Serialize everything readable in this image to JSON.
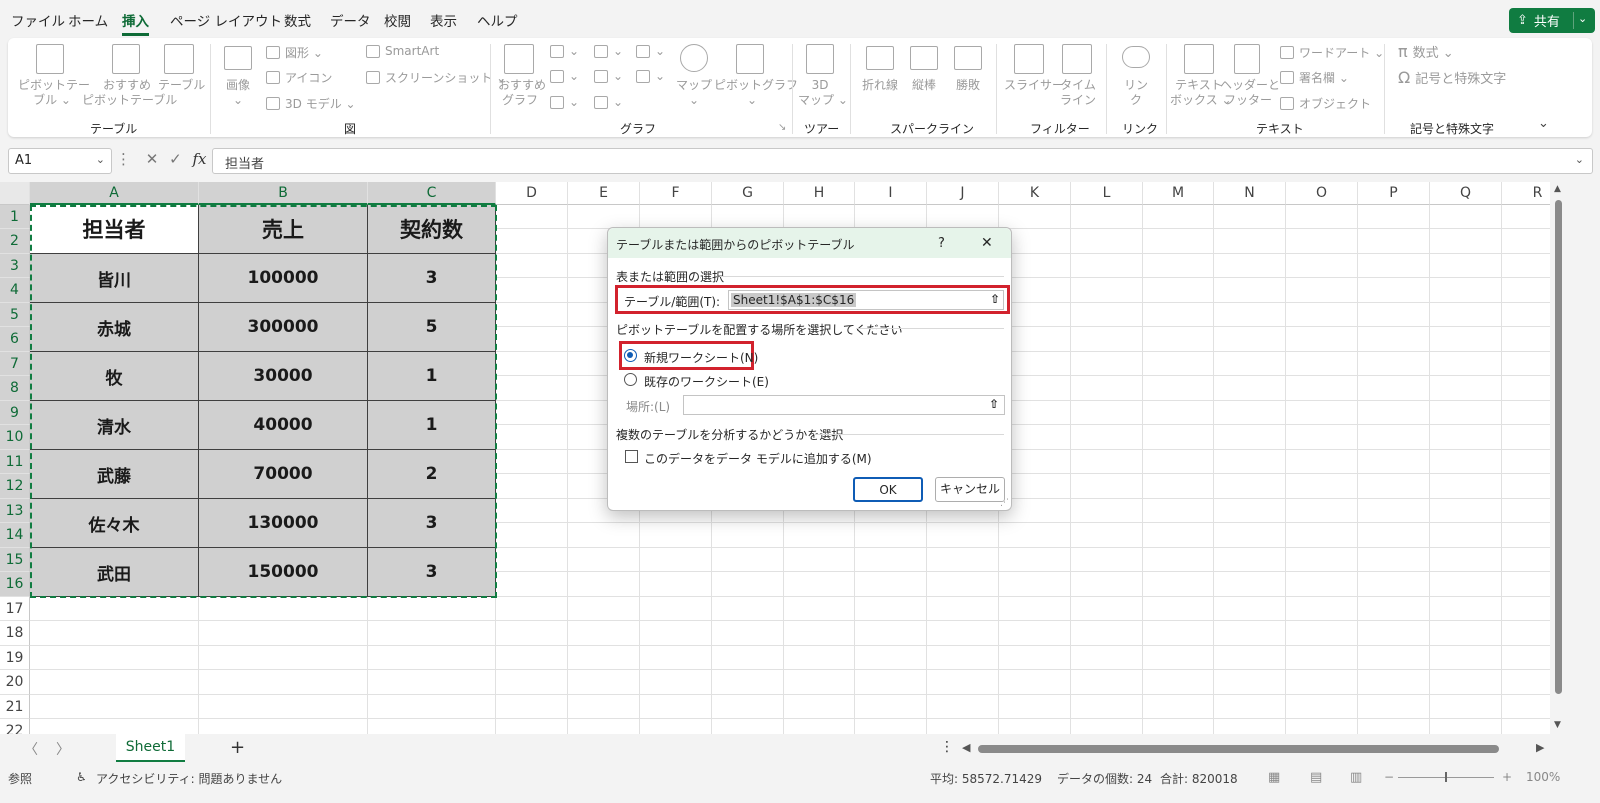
{
  "menu": {
    "items": [
      "ファイル",
      "ホーム",
      "挿入",
      "ページ レイアウト",
      "数式",
      "データ",
      "校閲",
      "表示",
      "ヘルプ"
    ],
    "active": "挿入",
    "share_label": "共有"
  },
  "ribbon": {
    "groups": {
      "table": {
        "label": "テーブル",
        "pivot": "ピボットテー\nブル ⌄",
        "recommended": "おすすめ\nピボットテーブル",
        "table": "テーブル"
      },
      "illustrations": {
        "label": "図",
        "image": "画像\n⌄",
        "shapes": "図形 ⌄",
        "icons": "アイコン",
        "models3d": "3D モデル ⌄",
        "smartart": "SmartArt",
        "screenshot": "スクリーンショット ⌄"
      },
      "charts": {
        "label": "グラフ",
        "recommended": "おすすめ\nグラフ",
        "maps": "マップ\n⌄",
        "pivotchart": "ピボットグラフ\n⌄"
      },
      "tours": {
        "label": "ツアー",
        "map3d": "3D\nマップ ⌄"
      },
      "sparklines": {
        "label": "スパークライン",
        "line": "折れ線",
        "column": "縦棒",
        "winloss": "勝敗"
      },
      "filters": {
        "label": "フィルター",
        "slicer": "スライサー",
        "timeline": "タイム\nライン"
      },
      "links": {
        "label": "リンク",
        "link": "リン\nク"
      },
      "text": {
        "label": "テキスト",
        "textbox": "テキスト\nボックス ⌄",
        "headerfooter": "ヘッダーと\nフッター",
        "wordart": "ワードアート ⌄",
        "signature": "署名欄 ⌄",
        "object": "オブジェクト"
      },
      "symbols": {
        "label": "記号と特殊文字",
        "equation": "数式 ⌄",
        "symbol": "記号と特殊文字"
      }
    }
  },
  "formula_bar": {
    "name_box": "A1",
    "content": "担当者",
    "fx": "fx"
  },
  "grid": {
    "columns": [
      "A",
      "B",
      "C",
      "D",
      "E",
      "F",
      "G",
      "H",
      "I",
      "J",
      "K",
      "L",
      "M",
      "N",
      "O",
      "P",
      "Q",
      "R"
    ],
    "rows": [
      "1",
      "2",
      "3",
      "4",
      "5",
      "6",
      "7",
      "8",
      "9",
      "10",
      "11",
      "12",
      "13",
      "14",
      "15",
      "16",
      "17",
      "18",
      "19",
      "20",
      "21",
      "22"
    ],
    "table_header": [
      "担当者",
      "売上",
      "契約数"
    ],
    "table_rows": [
      [
        "皆川",
        "100000",
        "3"
      ],
      [
        "赤城",
        "300000",
        "5"
      ],
      [
        "牧",
        "30000",
        "1"
      ],
      [
        "清水",
        "40000",
        "1"
      ],
      [
        "武藤",
        "70000",
        "2"
      ],
      [
        "佐々木",
        "130000",
        "3"
      ],
      [
        "武田",
        "150000",
        "3"
      ]
    ]
  },
  "dialog": {
    "title": "テーブルまたは範囲からのピボットテーブル",
    "help": "?",
    "close": "✕",
    "section1": "表または範囲の選択",
    "range_label": "テーブル/範囲(T):",
    "range_value": "Sheet1!$A$1:$C$16",
    "section2": "ピボットテーブルを配置する場所を選択してください",
    "new_sheet": "新規ワークシート(N)",
    "existing_sheet": "既存のワークシート(E)",
    "location_label": "場所:(L)",
    "location_value": "",
    "section3": "複数のテーブルを分析するかどうかを選択",
    "data_model": "このデータをデータ モデルに追加する(M)",
    "ok": "OK",
    "cancel": "キャンセル"
  },
  "sheet_tabs": {
    "active": "Sheet1",
    "add": "+"
  },
  "status": {
    "mode": "参照",
    "accessibility": "アクセシビリティ: 問題ありません",
    "average": "平均: 58572.71429",
    "count": "データの個数: 24",
    "sum": "合計: 820018",
    "zoom": "100%"
  },
  "colors": {
    "accent": "#107c41",
    "highlight": "#d2222d",
    "cell_fill": "#d0d0d0"
  }
}
